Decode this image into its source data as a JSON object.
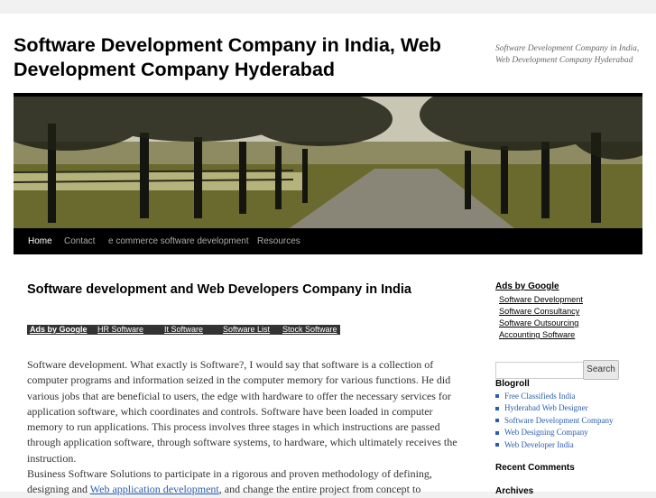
{
  "site": {
    "title": "Software Development Company in India, Web Development Company Hyderabad",
    "description": "Software Development Company in India, Web Development Company Hyderabad"
  },
  "nav": {
    "items": [
      "Home",
      "Contact",
      "e commerce software development",
      "Resources"
    ],
    "current": "Home"
  },
  "post": {
    "title": "Software development and Web Developers Company in India",
    "ads_bar": {
      "label": "Ads by Google",
      "links": [
        "HR Software",
        "It Software",
        "Software List",
        "Stock Software"
      ]
    },
    "paragraph1": "Software development. What exactly is Software?, I would say that software is a collection of computer programs and information seized in the computer memory for various functions. He did various jobs that are beneficial to users, the edge with hardware to offer the necessary services for application software, which coordinates and controls. Software have been loaded in computer memory to run applications. This process involves three stages in which instructions are passed through application software, through software systems, to hardware, which ultimately receives the instruction.",
    "paragraph2_before": "Business Software Solutions to participate in a rigorous and proven methodology of defining, designing and ",
    "paragraph2_link": "Web application development",
    "paragraph2_after": ", and change the entire project from concept to"
  },
  "sidebar": {
    "ads_title": "Ads by Google",
    "ads_links": [
      "Software Development",
      "Software Consultancy",
      "Software Outsourcing",
      "Accounting Software"
    ],
    "search_button": "Search",
    "search_value": "",
    "blogroll_title": "Blogroll",
    "blogroll": [
      "Free Classifieds India",
      "Hyderabad Web Designer",
      "Software Development Company",
      "Web Designing Company",
      "Web Developer India"
    ],
    "recent_comments_title": "Recent Comments",
    "archives_title": "Archives"
  }
}
